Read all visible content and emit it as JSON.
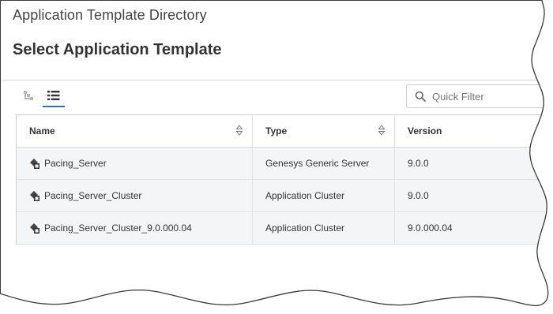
{
  "breadcrumb": "Application Template Directory",
  "page_title": "Select Application Template",
  "filter": {
    "placeholder": "Quick Filter",
    "value": ""
  },
  "table": {
    "columns": [
      "Name",
      "Type",
      "Version"
    ],
    "rows": [
      {
        "name": "Pacing_Server",
        "type": "Genesys Generic Server",
        "version": "9.0.0"
      },
      {
        "name": "Pacing_Server_Cluster",
        "type": "Application Cluster",
        "version": "9.0.0"
      },
      {
        "name": "Pacing_Server_Cluster_9.0.000.04",
        "type": "Application Cluster",
        "version": "9.0.000.04"
      }
    ]
  },
  "icons": {
    "hierarchy_view": "hierarchy-icon",
    "list_view": "list-icon",
    "search": "search-icon",
    "sort": "sort-icon",
    "template": "application-template-icon"
  },
  "colors": {
    "accent": "#2b73b8",
    "row_background": "#f4f5f7"
  }
}
